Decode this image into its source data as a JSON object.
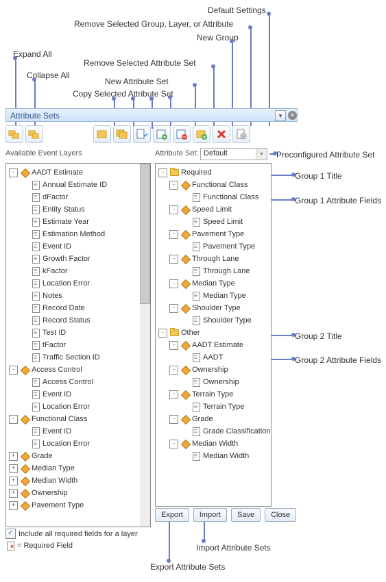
{
  "callouts": {
    "default_settings": "Default Settings",
    "remove_group": "Remove Selected Group, Layer, or Attribute",
    "new_group": "New Group",
    "expand_all": "Expand All",
    "remove_attr_set": "Remove Selected Attribute Set",
    "collapse_all": "Collapse All",
    "new_attr_set": "New Attribute Set",
    "copy_attr_set": "Copy Selected Attribute Set",
    "preconf": "Preconfigured Attribute Set",
    "group1_title": "Group 1 Title",
    "group1_fields": "Group 1 Attribute Fields",
    "group2_title": "Group 2 Title",
    "group2_fields": "Group 2 Attribute Fields",
    "import_sets": "Import Attribute Sets",
    "export_sets": "Export Attribute Sets"
  },
  "panel": {
    "title": "Attribute Sets"
  },
  "labels": {
    "available": "Available Event Layers",
    "attr_set": "Attribute Set:",
    "include_required": "Include all required fields for a layer",
    "legend": " = Required Field"
  },
  "dropdown": {
    "value": "Default"
  },
  "buttons": {
    "export": "Export",
    "import": "Import",
    "save": "Save",
    "close": "Close"
  },
  "left_tree": [
    {
      "d": 0,
      "tw": "-",
      "ic": "diamond",
      "t": "AADT Estimate"
    },
    {
      "d": 1,
      "tw": "",
      "ic": "page",
      "t": "Annual Estimate ID"
    },
    {
      "d": 1,
      "tw": "",
      "ic": "page",
      "t": "dFactor"
    },
    {
      "d": 1,
      "tw": "",
      "ic": "page",
      "t": "Entity Status"
    },
    {
      "d": 1,
      "tw": "",
      "ic": "page",
      "t": "Estimate Year"
    },
    {
      "d": 1,
      "tw": "",
      "ic": "page",
      "t": "Estimation Method"
    },
    {
      "d": 1,
      "tw": "",
      "ic": "page",
      "t": "Event ID"
    },
    {
      "d": 1,
      "tw": "",
      "ic": "page",
      "t": "Growth Factor"
    },
    {
      "d": 1,
      "tw": "",
      "ic": "page",
      "t": "kFactor"
    },
    {
      "d": 1,
      "tw": "",
      "ic": "page",
      "t": "Location Error"
    },
    {
      "d": 1,
      "tw": "",
      "ic": "page",
      "t": "Notes"
    },
    {
      "d": 1,
      "tw": "",
      "ic": "page",
      "t": "Record Date"
    },
    {
      "d": 1,
      "tw": "",
      "ic": "page",
      "t": "Record Status"
    },
    {
      "d": 1,
      "tw": "",
      "ic": "page",
      "t": "Test ID"
    },
    {
      "d": 1,
      "tw": "",
      "ic": "page",
      "t": "tFactor"
    },
    {
      "d": 1,
      "tw": "",
      "ic": "page",
      "t": "Traffic Section ID"
    },
    {
      "d": 0,
      "tw": "-",
      "ic": "diamond",
      "t": "Access Control"
    },
    {
      "d": 1,
      "tw": "",
      "ic": "page",
      "t": "Access Control"
    },
    {
      "d": 1,
      "tw": "",
      "ic": "page",
      "t": "Event ID"
    },
    {
      "d": 1,
      "tw": "",
      "ic": "page",
      "t": "Location Error"
    },
    {
      "d": 0,
      "tw": "-",
      "ic": "diamond",
      "t": "Functional Class"
    },
    {
      "d": 1,
      "tw": "",
      "ic": "page",
      "t": "Event ID"
    },
    {
      "d": 1,
      "tw": "",
      "ic": "page",
      "t": "Location Error"
    },
    {
      "d": 0,
      "tw": "+",
      "ic": "diamond",
      "t": "Grade"
    },
    {
      "d": 0,
      "tw": "+",
      "ic": "diamond",
      "t": "Median Type"
    },
    {
      "d": 0,
      "tw": "+",
      "ic": "diamond",
      "t": "Median Width"
    },
    {
      "d": 0,
      "tw": "+",
      "ic": "diamond",
      "t": "Ownership"
    },
    {
      "d": 0,
      "tw": "+",
      "ic": "diamond",
      "t": "Pavement Type"
    }
  ],
  "right_tree": [
    {
      "d": 0,
      "tw": "-",
      "ic": "folder",
      "t": "Required"
    },
    {
      "d": 1,
      "tw": "-",
      "ic": "diamond",
      "t": "Functional Class"
    },
    {
      "d": 2,
      "tw": "",
      "ic": "page",
      "t": "Functional Class"
    },
    {
      "d": 1,
      "tw": "-",
      "ic": "diamond",
      "t": "Speed Limit"
    },
    {
      "d": 2,
      "tw": "",
      "ic": "page",
      "t": "Speed Limit"
    },
    {
      "d": 1,
      "tw": "-",
      "ic": "diamond",
      "t": "Pavement Type"
    },
    {
      "d": 2,
      "tw": "",
      "ic": "page",
      "t": "Pavement Type"
    },
    {
      "d": 1,
      "tw": "-",
      "ic": "diamond",
      "t": "Through Lane"
    },
    {
      "d": 2,
      "tw": "",
      "ic": "page",
      "t": "Through Lane"
    },
    {
      "d": 1,
      "tw": "-",
      "ic": "diamond",
      "t": "Median Type"
    },
    {
      "d": 2,
      "tw": "",
      "ic": "page",
      "t": "Median Type"
    },
    {
      "d": 1,
      "tw": "-",
      "ic": "diamond",
      "t": "Shoulder Type"
    },
    {
      "d": 2,
      "tw": "",
      "ic": "page",
      "t": "Shoulder Type"
    },
    {
      "d": 0,
      "tw": "-",
      "ic": "folder",
      "t": "Other"
    },
    {
      "d": 1,
      "tw": "-",
      "ic": "diamond",
      "t": "AADT Estimate"
    },
    {
      "d": 2,
      "tw": "",
      "ic": "page",
      "t": "AADT"
    },
    {
      "d": 1,
      "tw": "-",
      "ic": "diamond",
      "t": "Ownership"
    },
    {
      "d": 2,
      "tw": "",
      "ic": "page",
      "t": "Ownership"
    },
    {
      "d": 1,
      "tw": "-",
      "ic": "diamond",
      "t": "Terrain Type"
    },
    {
      "d": 2,
      "tw": "",
      "ic": "page",
      "t": "Terrain Type"
    },
    {
      "d": 1,
      "tw": "-",
      "ic": "diamond",
      "t": "Grade"
    },
    {
      "d": 2,
      "tw": "",
      "ic": "page",
      "t": "Grade Classification"
    },
    {
      "d": 1,
      "tw": "-",
      "ic": "diamond",
      "t": "Median Width"
    },
    {
      "d": 2,
      "tw": "",
      "ic": "page",
      "t": "Median Width"
    }
  ]
}
